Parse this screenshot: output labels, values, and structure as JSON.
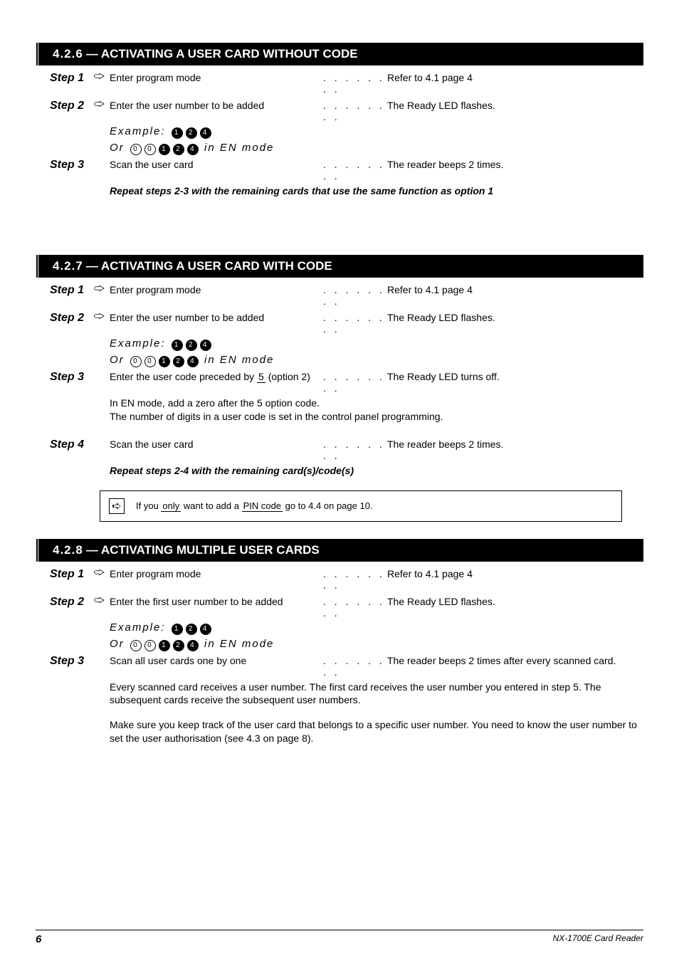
{
  "section1": {
    "num": "4.2.6",
    "title": "ACTIVATING A USER CARD WITHOUT CODE",
    "steps": [
      {
        "no": "Step 1",
        "hand": true,
        "left": "Enter program mode",
        "right": "Refer to 4.1 page 4"
      },
      {
        "no": "Step 2",
        "hand": true,
        "left": "Enter the user number to be added",
        "right": "The Ready LED flashes."
      }
    ],
    "keys_line1": [
      "1",
      "2",
      "4"
    ],
    "keys_line2": [
      "0",
      "0",
      "1",
      "2",
      "4"
    ],
    "keys_caption": "Or",
    "keys_caption2": "in EN mode",
    "scan": {
      "no": "Step 3",
      "left": "Scan the user card",
      "right": "The reader beeps 2 times."
    },
    "note": "Repeat steps 2-3 with the remaining cards that use the same function as option 1"
  },
  "section2": {
    "num": "4.2.7",
    "title": "ACTIVATING A USER CARD WITH CODE",
    "steps": [
      {
        "no": "Step 1",
        "hand": true,
        "left": "Enter program mode",
        "right": "Refer to 4.1 page 4"
      },
      {
        "no": "Step 2",
        "hand": true,
        "left": "Enter the user number to be added",
        "right": "The Ready LED flashes."
      }
    ],
    "keys_line1": [
      "1",
      "2",
      "4"
    ],
    "keys_line2": [
      "0",
      "0",
      "1",
      "2",
      "4"
    ],
    "keys_caption": "Or",
    "keys_caption2": "in EN mode",
    "step3": {
      "no": "Step 3",
      "left_a": "Enter the user code preceded by",
      "left_b": "(option 2)",
      "under": "5",
      "right1": "The Ready LED turns off.",
      "extra": "In EN mode, add a zero after the 5 option code.",
      "extra2": "The number of digits in a user code is set in the control panel programming."
    },
    "scan": {
      "no": "Step 4",
      "left": "Scan the user card",
      "right": "The reader beeps 2 times."
    },
    "note_main": "Repeat steps 2-4 with the remaining card(s)/code(s)",
    "note_box": "If you only want to add a PIN code go to 4.4 on page 10."
  },
  "section3": {
    "num": "4.2.8",
    "title": "ACTIVATING MULTIPLE USER CARDS",
    "steps": [
      {
        "no": "Step 1",
        "hand": true,
        "left": "Enter program mode",
        "right": "Refer to 4.1 page 4"
      },
      {
        "no": "Step 2",
        "hand": true,
        "left": "Enter the first user number to be added",
        "right": "The Ready LED flashes."
      }
    ],
    "keys_line1": [
      "1",
      "2",
      "4"
    ],
    "keys_line2": [
      "0",
      "0",
      "1",
      "2",
      "4"
    ],
    "keys_caption": "Or",
    "keys_caption2": "in EN mode",
    "scan": {
      "no": "Step 3",
      "left": "Scan all user cards one by one",
      "right": "The reader beeps 2 times after every scanned card."
    },
    "note1": "Every scanned card receives a user number. The first card receives the user number you entered in step 5. The subsequent cards receive the subsequent user numbers.",
    "note2": "Make sure you keep track of the user card that belongs to a specific user number. You need to know the user number to set the user authorisation (see 4.3 on page 8)."
  },
  "footer": {
    "page": "6",
    "doc": "NX-1700E Card Reader"
  },
  "glyph": {
    "dots": ". . . . . . . ."
  }
}
